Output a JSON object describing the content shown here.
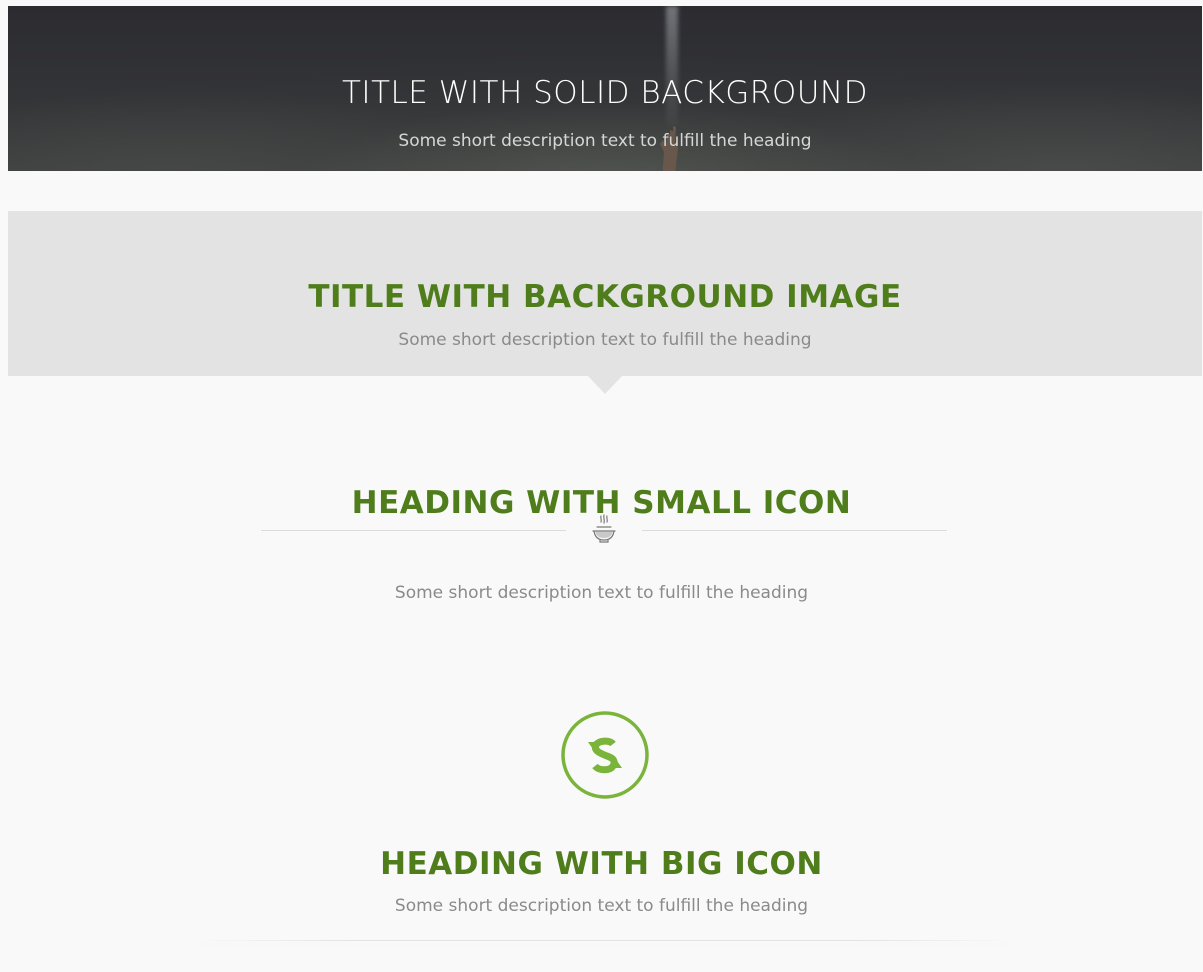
{
  "solid_section": {
    "title": "TITLE WITH SOLID BACKGROUND",
    "description": "Some short description text to fulfill the heading"
  },
  "image_section": {
    "title": "TITLE WITH BACKGROUND IMAGE",
    "description": "Some short description text to fulfill the heading"
  },
  "small_icon_section": {
    "title": "HEADING WITH SMALL ICON",
    "icon": "steaming-bowl-icon",
    "description": "Some short description text to fulfill the heading"
  },
  "big_icon_section": {
    "title": "HEADING WITH BIG ICON",
    "icon": "s-logo-circle-icon",
    "description": "Some short description text to fulfill the heading"
  },
  "colors": {
    "accent_green": "#4f7d1b",
    "icon_green": "#7ab43a",
    "grey_box": "#e3e3e3",
    "description_grey": "#8a8a8a"
  }
}
